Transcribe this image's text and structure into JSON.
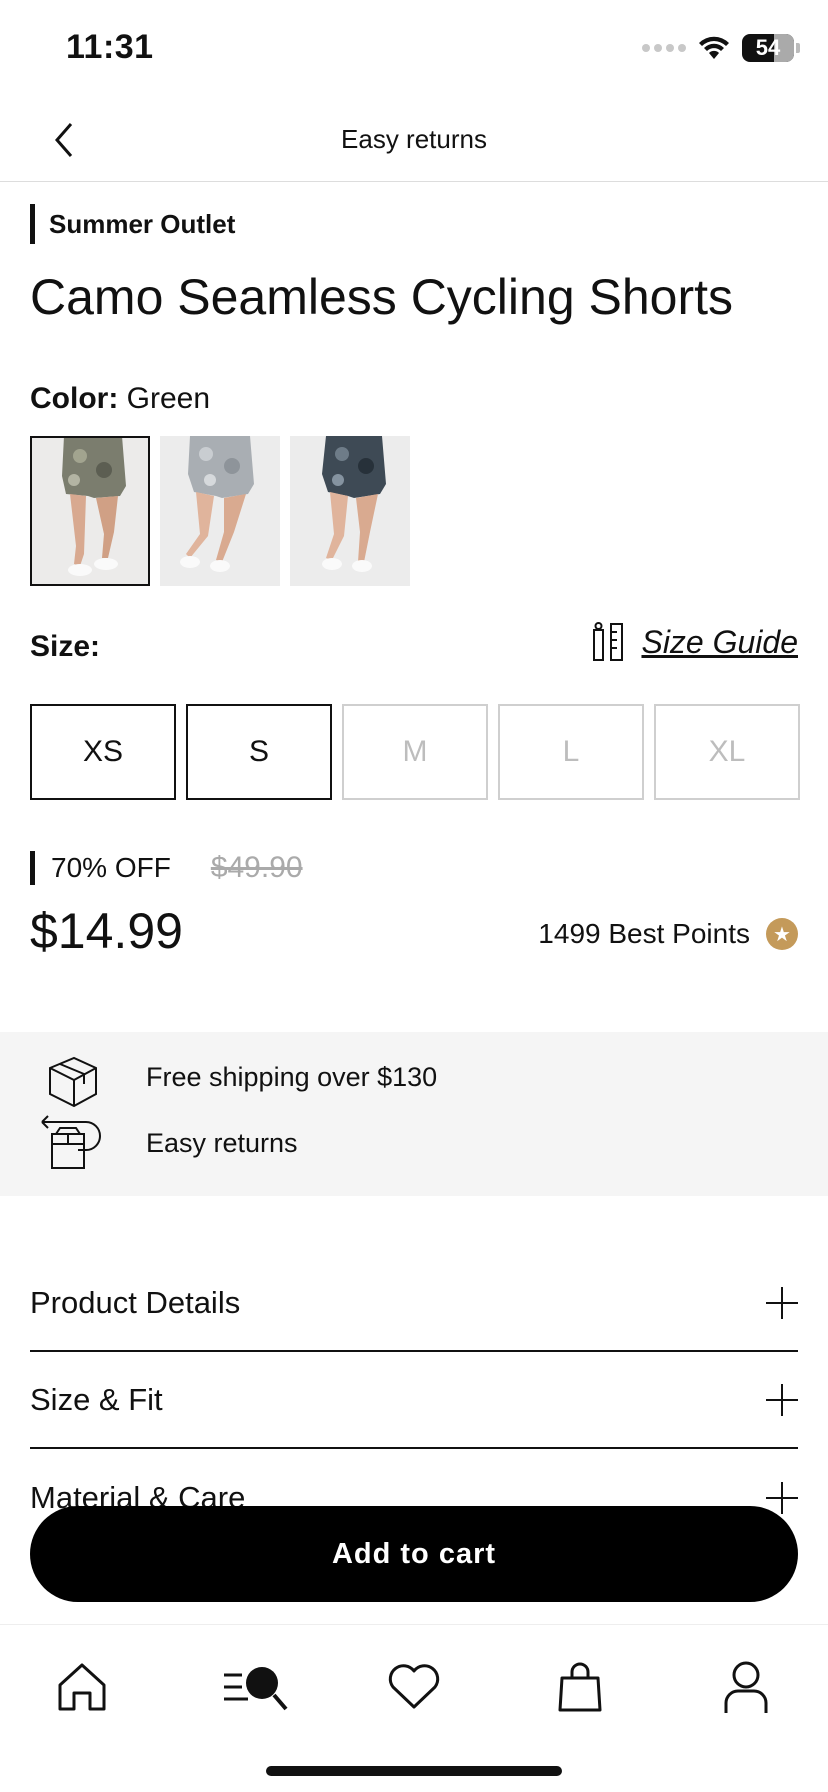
{
  "status_bar": {
    "time": "11:31",
    "battery": "54"
  },
  "nav": {
    "title": "Easy returns"
  },
  "product": {
    "eyebrow": "Summer Outlet",
    "title": "Camo Seamless Cycling Shorts",
    "color_label": "Color:",
    "color_value": "Green",
    "swatches": [
      "Green",
      "Grey",
      "Blue"
    ],
    "size_label": "Size:",
    "size_guide": "Size Guide",
    "sizes": [
      {
        "label": "XS",
        "available": true
      },
      {
        "label": "S",
        "available": true
      },
      {
        "label": "M",
        "available": false
      },
      {
        "label": "L",
        "available": false
      },
      {
        "label": "XL",
        "available": false
      }
    ],
    "discount": "70% OFF",
    "old_price": "$49.90",
    "price": "$14.99",
    "points": "1499 Best Points"
  },
  "info": {
    "shipping": "Free shipping over $130",
    "returns": "Easy returns"
  },
  "accordions": [
    {
      "title": "Product Details"
    },
    {
      "title": "Size & Fit"
    },
    {
      "title": "Material & Care"
    }
  ],
  "cta": {
    "add_to_cart": "Add to cart"
  },
  "tab_bar": {
    "tabs": [
      "home-icon",
      "search-icon",
      "heart-icon",
      "bag-icon",
      "user-icon"
    ]
  },
  "colors": {
    "points_gold": "#c49a5a",
    "accent": "#000000"
  }
}
